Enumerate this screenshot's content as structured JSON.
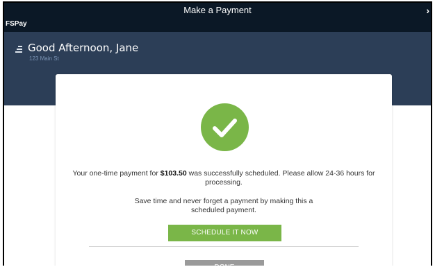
{
  "window": {
    "title": "Make a Payment",
    "chevron": "›"
  },
  "header": {
    "app_name": "FSPay",
    "greeting": "Good Afternoon, Jane",
    "address": "123 Main St"
  },
  "confirmation": {
    "icon": "checkmark-icon",
    "message_prefix": "Your one-time payment for ",
    "amount": "$103.50",
    "message_suffix": " was successfully scheduled. Please allow 24-36 hours for processing.",
    "promo": "Save time and never forget a payment by making this a scheduled payment.",
    "schedule_label": "SCHEDULE IT NOW",
    "done_label": "DONE"
  },
  "colors": {
    "titlebar": "#0b1826",
    "header": "#2c3e57",
    "accent_green": "#7ab648",
    "done_gray": "#9a9a9a"
  }
}
